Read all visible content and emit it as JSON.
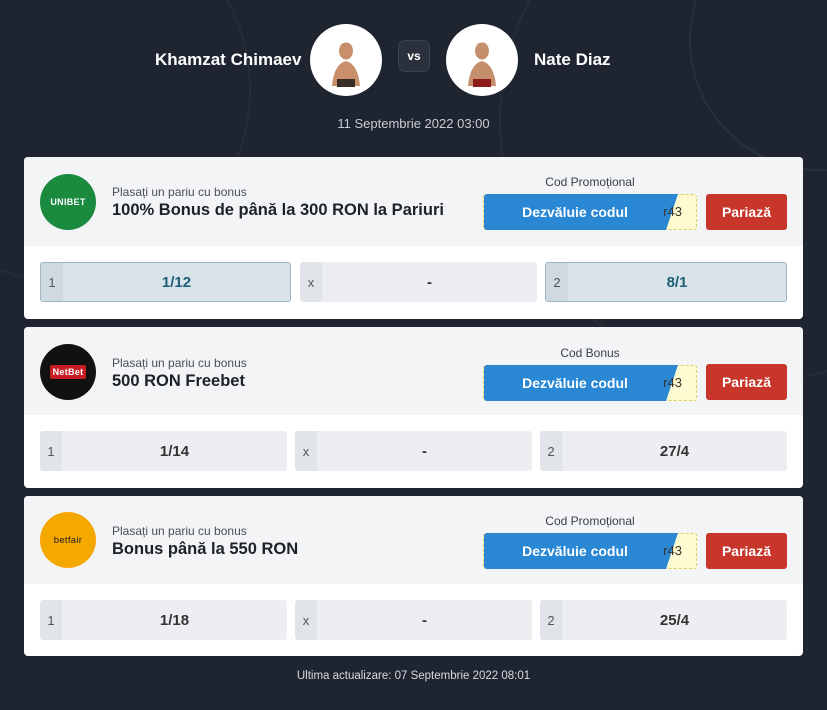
{
  "fight": {
    "fighter_left": "Khamzat Chimaev",
    "fighter_right": "Nate Diaz",
    "vs": "vs",
    "date": "11 Septembrie 2022 03:00"
  },
  "offers": [
    {
      "bookmaker": "UNIBET",
      "logo_color": "#1a8a3f",
      "subtitle": "Plasați un pariu cu bonus",
      "title": "100% Bonus de până la 300 RON la Pariuri",
      "code_label": "Cod Promoțional",
      "reveal_label": "Dezvăluie codul",
      "code": "r43",
      "bet_label": "Pariază",
      "odds": [
        {
          "key": "1",
          "value": "1/12"
        },
        {
          "key": "x",
          "value": "-"
        },
        {
          "key": "2",
          "value": "8/1"
        }
      ]
    },
    {
      "bookmaker": "NetBet",
      "logo_color": "#111111",
      "subtitle": "Plasați un pariu cu bonus",
      "title": "500 RON Freebet",
      "code_label": "Cod Bonus",
      "reveal_label": "Dezvăluie codul",
      "code": "r43",
      "bet_label": "Pariază",
      "odds": [
        {
          "key": "1",
          "value": "1/14"
        },
        {
          "key": "x",
          "value": "-"
        },
        {
          "key": "2",
          "value": "27/4"
        }
      ]
    },
    {
      "bookmaker": "betfair",
      "logo_color": "#f5a800",
      "subtitle": "Plasați un pariu cu bonus",
      "title": "Bonus până la 550 RON",
      "code_label": "Cod Promoțional",
      "reveal_label": "Dezvăluie codul",
      "code": "r43",
      "bet_label": "Pariază",
      "odds": [
        {
          "key": "1",
          "value": "1/18"
        },
        {
          "key": "x",
          "value": "-"
        },
        {
          "key": "2",
          "value": "25/4"
        }
      ]
    }
  ],
  "footer": {
    "last_update": "Ultima actualizare: 07 Septembrie 2022 08:01"
  }
}
